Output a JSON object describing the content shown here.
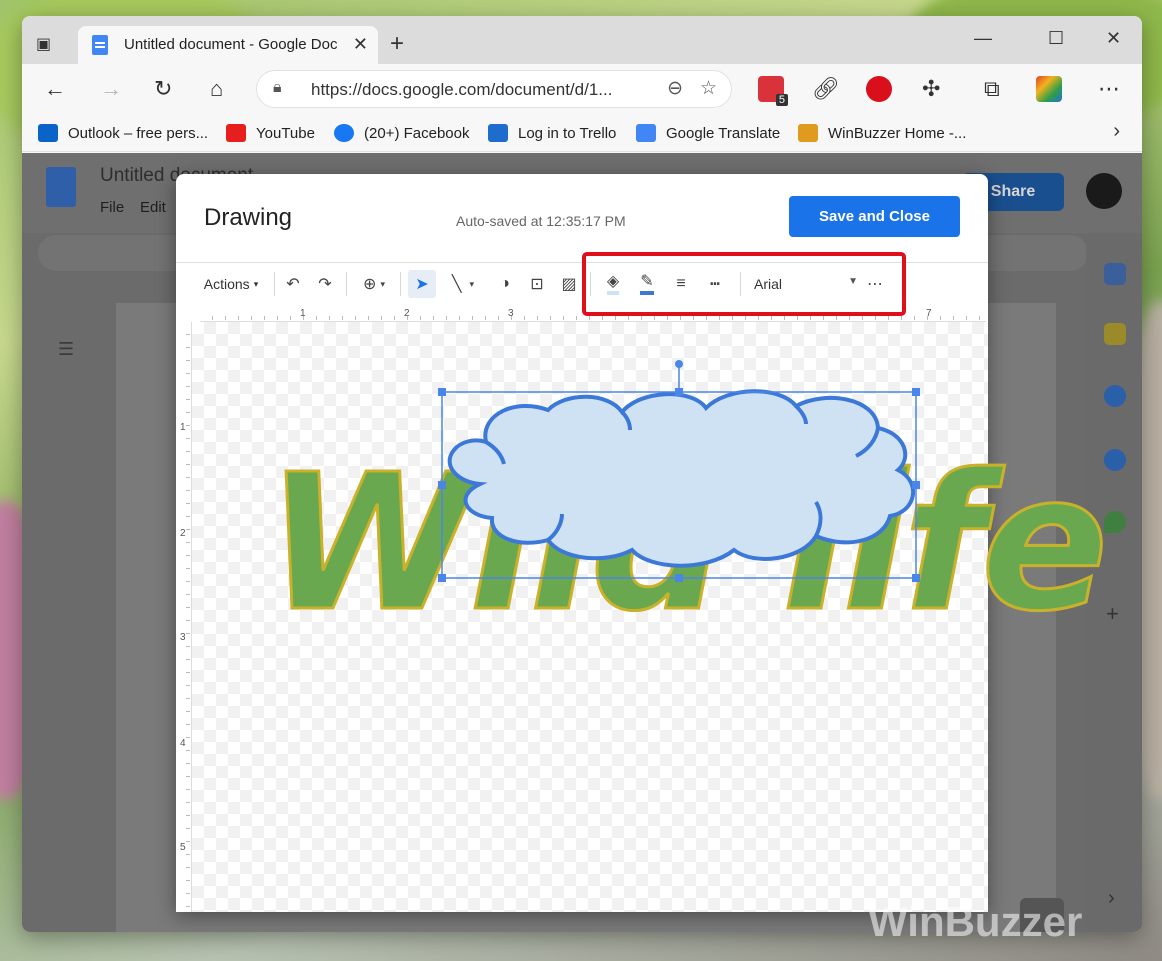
{
  "browser": {
    "tab_title": "Untitled document - Google Doc",
    "url": "https://docs.google.com/document/d/1...",
    "ext_badge": "5"
  },
  "bookmarks": [
    {
      "label": "Outlook – free pers...",
      "color": "#0a64c8"
    },
    {
      "label": "YouTube",
      "color": "#e61e1e"
    },
    {
      "label": "(20+) Facebook",
      "color": "#1877f2"
    },
    {
      "label": "Log in to Trello",
      "color": "#1e6ccc"
    },
    {
      "label": "Google Translate",
      "color": "#4285f4"
    },
    {
      "label": "WinBuzzer Home -...",
      "color": "#e09a1e"
    }
  ],
  "doc": {
    "title": "Untitled document",
    "menu": [
      "File",
      "Edit"
    ],
    "share_label": "Share"
  },
  "drawing": {
    "title": "Drawing",
    "autosave": "Auto-saved at 12:35:17 PM",
    "save_close": "Save and Close",
    "actions_label": "Actions",
    "font_name": "Arial",
    "wordart_text": "Wild life",
    "ruler_h": [
      "1",
      "2",
      "3",
      "7"
    ],
    "ruler_v": [
      "1",
      "2",
      "3",
      "4",
      "5"
    ]
  },
  "colors": {
    "accent": "#1a73e8",
    "highlight": "#e0101a",
    "cloud_fill": "#cfe2f3",
    "cloud_stroke": "#3c78d8",
    "wordart_fill": "#6aa84f"
  },
  "watermark": "WinBuzzer"
}
